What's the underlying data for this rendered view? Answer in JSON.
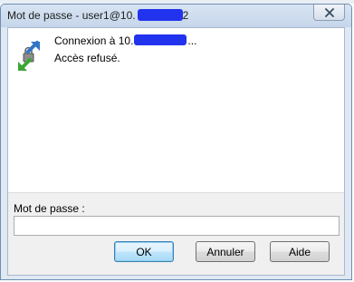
{
  "window": {
    "title_prefix": "Mot de passe - user1@10.",
    "title_suffix": "2"
  },
  "message": {
    "line1_prefix": "Connexion à 10.",
    "line1_suffix": "...",
    "line2": "Accès refusé."
  },
  "password": {
    "label": "Mot de passe :",
    "value": "",
    "placeholder": ""
  },
  "buttons": {
    "ok": "OK",
    "cancel": "Annuler",
    "help": "Aide"
  },
  "colors": {
    "redaction": "#2233ee",
    "default_button_border": "#3c7fb1"
  },
  "icons": {
    "app": "connection-arrows-icon",
    "close": "close-icon"
  }
}
